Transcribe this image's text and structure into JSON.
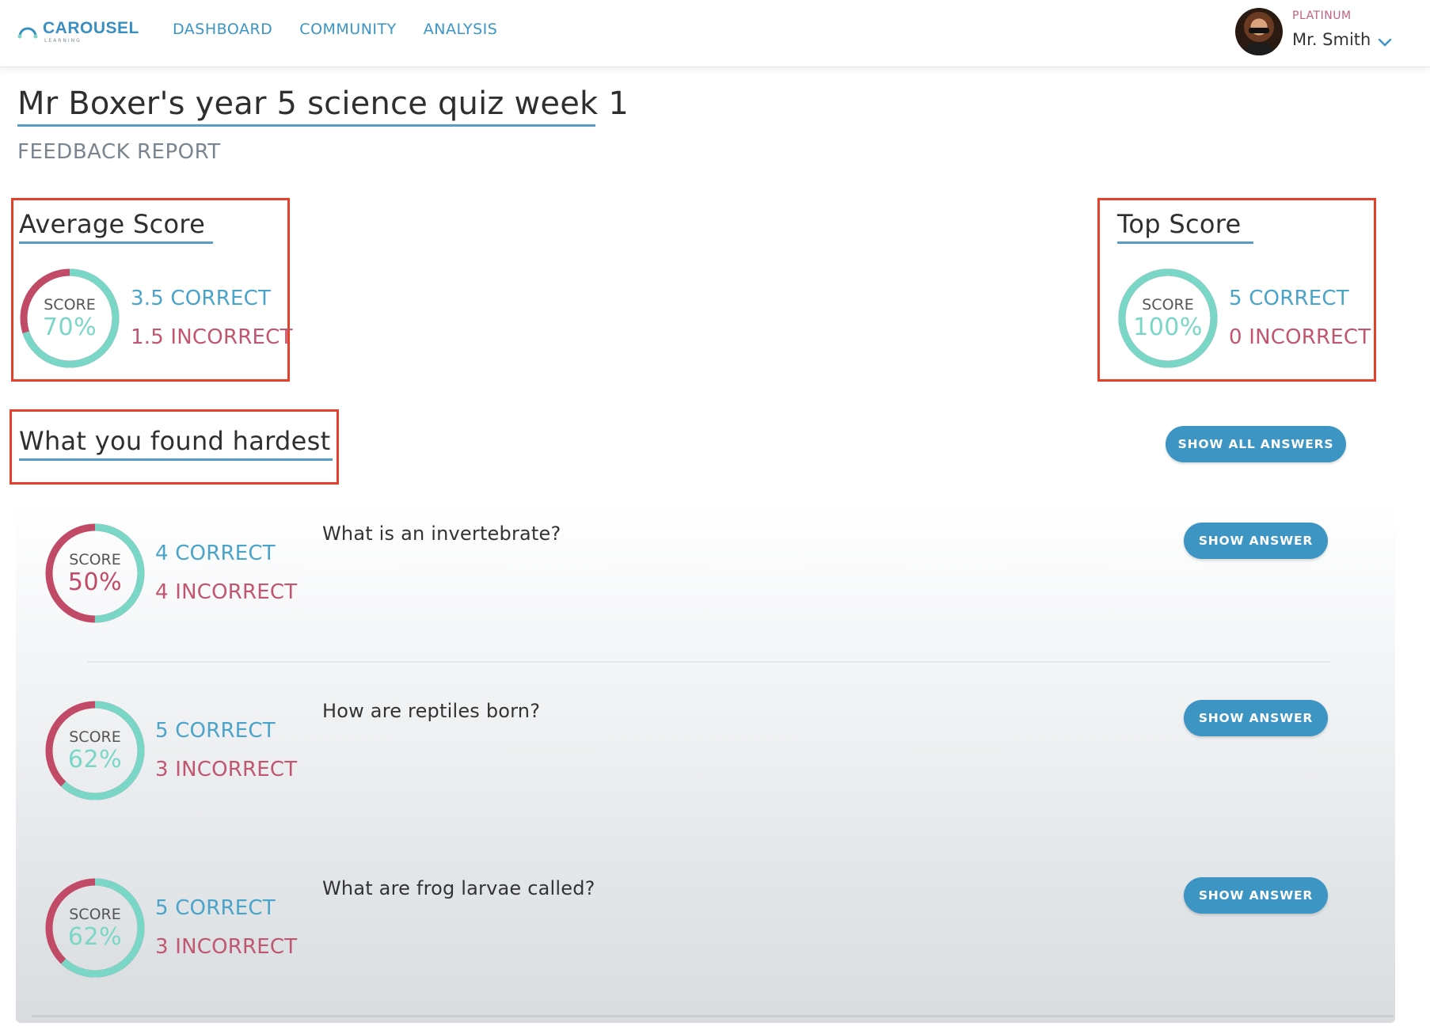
{
  "brand": {
    "name": "CAROUSEL",
    "tagline": "LEARNING",
    "logo_icon": "carousel-logo-icon",
    "color": "#3a8fc1"
  },
  "nav": {
    "items": [
      {
        "label": "DASHBOARD"
      },
      {
        "label": "COMMUNITY"
      },
      {
        "label": "ANALYSIS"
      }
    ]
  },
  "user": {
    "tier": "PLATINUM",
    "name": "Mr. Smith",
    "menu_icon": "chevron-down-icon"
  },
  "page": {
    "title": "Mr Boxer's year 5 science quiz week 1",
    "subtitle": "FEEDBACK REPORT"
  },
  "average_score": {
    "heading": "Average Score",
    "score_label": "SCORE",
    "percent_text": "70%",
    "percent": 70,
    "correct_text": "3.5 CORRECT",
    "incorrect_text": "1.5 INCORRECT"
  },
  "top_score": {
    "heading": "Top Score",
    "score_label": "SCORE",
    "percent_text": "100%",
    "percent": 100,
    "correct_text": "5 CORRECT",
    "incorrect_text": "0 INCORRECT"
  },
  "hardest": {
    "heading": "What you found hardest",
    "show_all_label": "SHOW ALL ANSWERS",
    "questions": [
      {
        "question": "What is an invertebrate?",
        "score_label": "SCORE",
        "percent_text": "50%",
        "percent": 50,
        "correct_text": "4 CORRECT",
        "incorrect_text": "4 INCORRECT",
        "button_label": "SHOW ANSWER"
      },
      {
        "question": "How are reptiles born?",
        "score_label": "SCORE",
        "percent_text": "62%",
        "percent": 62,
        "correct_text": "5 CORRECT",
        "incorrect_text": "3 INCORRECT",
        "button_label": "SHOW ANSWER"
      },
      {
        "question": "What are frog larvae called?",
        "score_label": "SCORE",
        "percent_text": "62%",
        "percent": 62,
        "correct_text": "5 CORRECT",
        "incorrect_text": "3 INCORRECT",
        "button_label": "SHOW ANSWER"
      }
    ]
  },
  "colors": {
    "accent_blue": "#3d95c3",
    "correct_teal": "#7ad7c7",
    "incorrect_pink": "#c14a66",
    "highlight_red": "#e4412c"
  }
}
